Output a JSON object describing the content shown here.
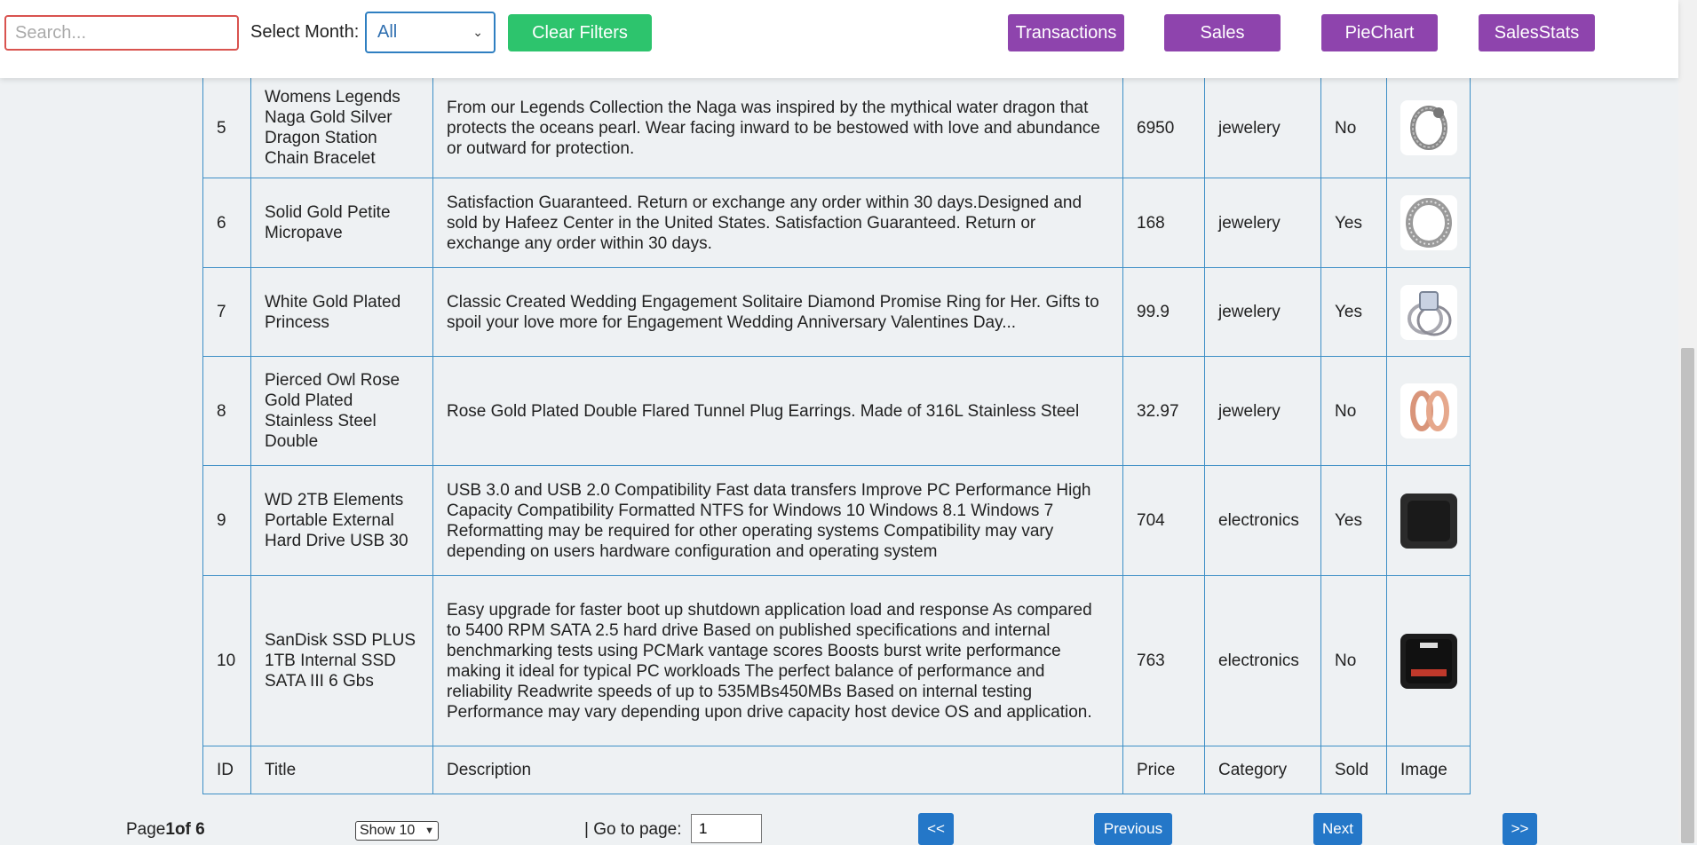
{
  "toolbar": {
    "search_placeholder": "Search...",
    "month_label": "Select Month:",
    "month_value": "All",
    "clear_label": "Clear Filters",
    "nav": [
      "Transactions",
      "Sales",
      "PieChart",
      "SalesStats"
    ]
  },
  "table": {
    "rows": [
      {
        "id": "5",
        "title": "Womens Legends Naga Gold Silver Dragon Station Chain Bracelet",
        "desc": "From our Legends Collection the Naga was inspired by the mythical water dragon that protects the oceans pearl. Wear facing inward to be bestowed with love and abundance or outward for protection.",
        "price": "6950",
        "category": "jewelery",
        "sold": "No",
        "image": "bracelet"
      },
      {
        "id": "6",
        "title": "Solid Gold Petite Micropave",
        "desc": "Satisfaction Guaranteed. Return or exchange any order within 30 days.Designed and sold by Hafeez Center in the United States. Satisfaction Guaranteed. Return or exchange any order within 30 days.",
        "price": "168",
        "category": "jewelery",
        "sold": "Yes",
        "image": "ring"
      },
      {
        "id": "7",
        "title": "White Gold Plated Princess",
        "desc": "Classic Created Wedding Engagement Solitaire Diamond Promise Ring for Her. Gifts to spoil your love more for Engagement Wedding Anniversary Valentines Day...",
        "price": "99.9",
        "category": "jewelery",
        "sold": "Yes",
        "image": "diamond-ring"
      },
      {
        "id": "8",
        "title": "Pierced Owl Rose Gold Plated Stainless Steel Double",
        "desc": "Rose Gold Plated Double Flared Tunnel Plug Earrings. Made of 316L Stainless Steel",
        "price": "32.97",
        "category": "jewelery",
        "sold": "No",
        "image": "earrings"
      },
      {
        "id": "9",
        "title": "WD 2TB Elements Portable External Hard Drive USB 30",
        "desc": "USB 3.0 and USB 2.0 Compatibility Fast data transfers Improve PC Performance High Capacity Compatibility Formatted NTFS for Windows 10 Windows 8.1 Windows 7 Reformatting may be required for other operating systems Compatibility may vary depending on users hardware configuration and operating system",
        "price": "704",
        "category": "electronics",
        "sold": "Yes",
        "image": "hard-drive"
      },
      {
        "id": "10",
        "title": "SanDisk SSD PLUS 1TB Internal SSD SATA III 6 Gbs",
        "desc": "Easy upgrade for faster boot up shutdown application load and response As compared to 5400 RPM SATA 2.5 hard drive Based on published specifications and internal benchmarking tests using PCMark vantage scores Boosts burst write performance making it ideal for typical PC workloads The perfect balance of performance and reliability Readwrite speeds of up to 535MBs450MBs Based on internal testing Performance may vary depending upon drive capacity host device OS and application.",
        "price": "763",
        "category": "electronics",
        "sold": "No",
        "image": "ssd"
      }
    ],
    "footer": {
      "id": "ID",
      "title": "Title",
      "desc": "Description",
      "price": "Price",
      "category": "Category",
      "sold": "Sold",
      "image": "Image"
    }
  },
  "pagination": {
    "page_prefix": "Page",
    "page_current": "1",
    "page_suffix": "of 6",
    "show_label": "Show 10",
    "goto_label": "| Go to page:",
    "goto_value": "1",
    "first": "<<",
    "prev": "Previous",
    "next": "Next",
    "last": ">>"
  },
  "colors": {
    "accent_purple": "#8e44ad",
    "accent_green": "#2dc46d",
    "accent_blue": "#2477c8",
    "table_border": "#3d8fc6"
  }
}
